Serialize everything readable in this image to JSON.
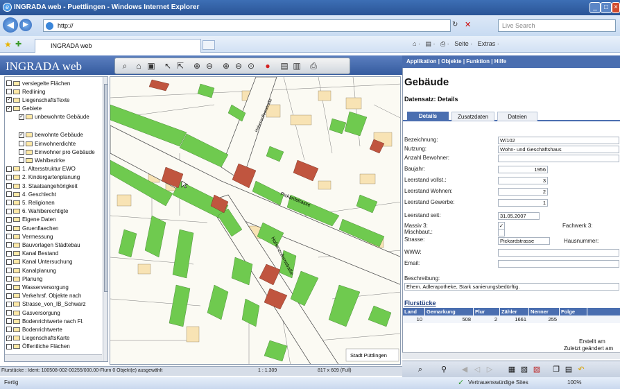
{
  "window": {
    "title": "INGRADA web - Puettlingen - Windows Internet Explorer",
    "min": "_",
    "max": "□",
    "close": "×"
  },
  "browser": {
    "address": "http://",
    "search_placeholder": "Live Search",
    "tab_label": "INGRADA web",
    "cmd": {
      "home": "⌂ ·",
      "feeds": "▤ ·",
      "print": "⎙ ·",
      "page": "Seite ·",
      "extras": "Extras ·"
    }
  },
  "app": {
    "title": "INGRADA web",
    "menu": {
      "applikation": "Applikation",
      "objekte": "Objekte",
      "funktion": "Funktion",
      "hilfe": "Hilfe"
    }
  },
  "layers": [
    {
      "label": "versiegelte Flächen",
      "checked": false
    },
    {
      "label": "Redlining",
      "checked": false
    },
    {
      "label": "LiegenschaftsTexte",
      "checked": true
    },
    {
      "label": "Gebiete",
      "checked": true
    },
    {
      "label": "unbewohnte Gebäude",
      "checked": true,
      "indent": true
    },
    {
      "label": "bewohnte Gebäude",
      "checked": true,
      "indent": true
    },
    {
      "label": "Einwohnerdichte",
      "checked": false,
      "indent": true
    },
    {
      "label": "Einwohner pro Gebäude",
      "checked": false,
      "indent": true
    },
    {
      "label": "Wahlbezirke",
      "checked": false,
      "indent": true
    },
    {
      "label": "1. Altersstruktur EWO",
      "checked": false
    },
    {
      "label": "2. Kindergartenplanung",
      "checked": false
    },
    {
      "label": "3. Staatsangehörigkeit",
      "checked": false
    },
    {
      "label": "4. Geschlecht",
      "checked": false
    },
    {
      "label": "5. Religionen",
      "checked": false
    },
    {
      "label": "6. Wahlberechtigte",
      "checked": false
    },
    {
      "label": "Eigene Daten",
      "checked": false
    },
    {
      "label": "Gruenflaechen",
      "checked": false
    },
    {
      "label": "Vermessung",
      "checked": false
    },
    {
      "label": "Bauvorlagen Städtebau",
      "checked": false
    },
    {
      "label": "Kanal Bestand",
      "checked": false
    },
    {
      "label": "Kanal Untersuchung",
      "checked": false
    },
    {
      "label": "Kanalplanung",
      "checked": false
    },
    {
      "label": "Planung",
      "checked": false
    },
    {
      "label": "Wasserversorgung",
      "checked": false
    },
    {
      "label": "Verkehrsf. Objekte nach",
      "checked": false
    },
    {
      "label": "Strasse_von_IB_Schwarz",
      "checked": false
    },
    {
      "label": "Gasversorgung",
      "checked": false
    },
    {
      "label": "Bodenrichtwerte nach Fl.",
      "checked": false
    },
    {
      "label": "Bodenrichtwerte",
      "checked": false
    },
    {
      "label": "LiegenschaftsKarte",
      "checked": true
    },
    {
      "label": "Öffentliche Flächen",
      "checked": false
    }
  ],
  "map": {
    "streets": [
      "Hohenzollernstraße",
      "Pickardstrasse",
      "Hohenzollernstraße"
    ],
    "place_label": "Stadt Püttlingen"
  },
  "status": {
    "selection": "Flurstücke : Ident: 100508-002-00255/000.00-Flurn 0 Objekt(e) ausgewählt",
    "scale": "1 : 1.309",
    "size": "817 x 609 (Full)"
  },
  "iestatus": {
    "left": "Fertig",
    "trust": "Vertrauenswürdige Sites",
    "zoom": "100%"
  },
  "detail": {
    "title": "Gebäude",
    "subtitle": "Datensatz: Details",
    "tabs": [
      "Details",
      "Zusatzdaten",
      "Dateien"
    ],
    "fields": {
      "bezeichnung": {
        "label": "Bezeichnung:",
        "value": "W/102"
      },
      "nutzung": {
        "label": "Nutzung:",
        "value": "Wohn- und Geschäftshaus"
      },
      "bewohner": {
        "label": "Anzahl Bewohner:",
        "value": ""
      },
      "baujahr": {
        "label": "Baujahr:",
        "value": "1956"
      },
      "leer_voll": {
        "label": "Leerstand vollst.:",
        "value": "3"
      },
      "leer_wohnen": {
        "label": "Leerstand Wohnen:",
        "value": "2"
      },
      "leer_gewerbe": {
        "label": "Leerstand Gewerbe:",
        "value": "1"
      },
      "leer_seit": {
        "label": "Leerstand seit:",
        "value": "31.05.2007"
      },
      "massiv": {
        "label": "Massiv 3:",
        "value": "✓"
      },
      "fachwerk": {
        "label": "Fachwerk 3:"
      },
      "mischbau": {
        "label": "Mischbaut.:"
      },
      "strasse": {
        "label": "Strasse:",
        "value": "Pickardstrasse"
      },
      "hausnummer": {
        "label": "Hausnummer:"
      },
      "www": {
        "label": "WWW:",
        "value": ""
      },
      "email": {
        "label": "Email:",
        "value": ""
      },
      "beschreibung": {
        "label": "Beschreibung:",
        "value": "Ehem. Adlerapotheke, Stark sanierungsbedürftig."
      }
    },
    "flurstuecke": {
      "heading": "Flurstücke",
      "columns": [
        "Land",
        "Gemarkung",
        "Flur",
        "Zähler",
        "Nenner",
        "Folge"
      ],
      "rows": [
        [
          "10",
          "508",
          "2",
          "1661",
          "255",
          ""
        ]
      ]
    },
    "footer1": "Erstellt am",
    "footer2": "Zuletzt geändert am"
  },
  "colors": {
    "inhabited": "#6fca4f",
    "uninhabited": "#c0553f",
    "parcel": "#f8e3b4",
    "accent": "#4a6eb0"
  }
}
